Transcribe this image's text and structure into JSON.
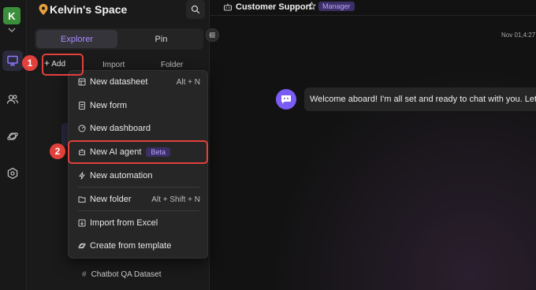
{
  "user": {
    "avatar_letter": "K"
  },
  "space": {
    "name": "Kelvin's Space"
  },
  "explorer": {
    "tabs": [
      "Explorer",
      "Pin"
    ],
    "toolbar": {
      "add": "Add",
      "import": "Import",
      "folder": "Folder"
    },
    "last_item": "Chatbot QA Dataset"
  },
  "callouts": {
    "one": "1",
    "two": "2"
  },
  "menu": {
    "items": [
      {
        "label": "New datasheet",
        "shortcut": "Alt + N",
        "icon": "datasheet-icon"
      },
      {
        "label": "New form",
        "shortcut": "",
        "icon": "form-icon"
      },
      {
        "label": "New dashboard",
        "shortcut": "",
        "icon": "dashboard-icon"
      },
      {
        "label": "New AI agent",
        "shortcut": "",
        "icon": "robot-icon",
        "badge": "Beta"
      },
      {
        "label": "New automation",
        "shortcut": "",
        "icon": "lightning-icon"
      },
      {
        "label": "New folder",
        "shortcut": "Alt + Shift + N",
        "icon": "folder-icon"
      },
      {
        "label": "Import from Excel",
        "shortcut": "",
        "icon": "excel-import-icon"
      },
      {
        "label": "Create from template",
        "shortcut": "",
        "icon": "template-icon"
      }
    ]
  },
  "chat": {
    "title": "Customer Support",
    "role": "Manager",
    "timestamp": "Nov 01,4:27",
    "message": "Welcome aboard! I'm all set and ready to chat with you. Let's h"
  },
  "colors": {
    "accent": "#7b5cf6",
    "callout": "#e2403a",
    "background": "#121212"
  }
}
